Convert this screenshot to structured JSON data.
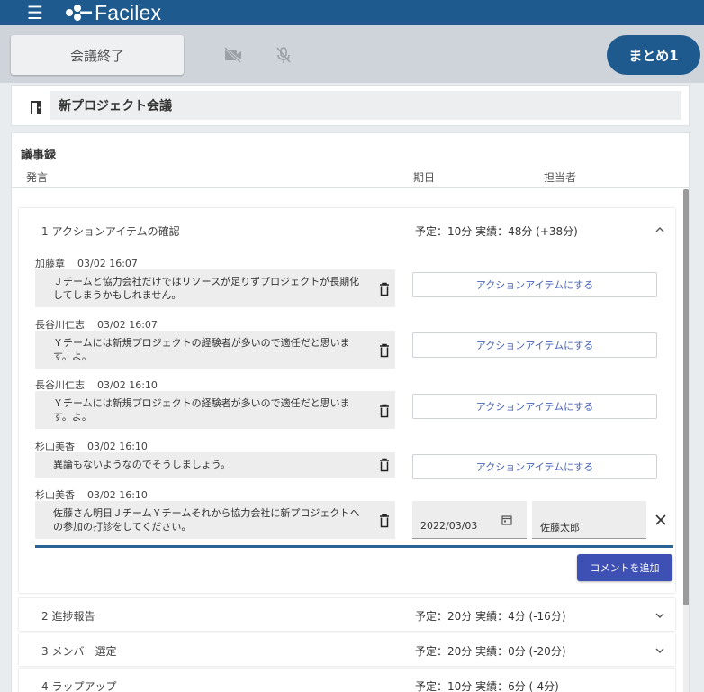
{
  "app": {
    "name": "Facilex"
  },
  "toolbar": {
    "end_meeting_label": "会議終了",
    "summary_label": "まとめ1"
  },
  "meeting": {
    "title": "新プロジェクト会議"
  },
  "minutes": {
    "title": "議事録",
    "columns": {
      "statement": "発言",
      "due_date": "期日",
      "assignee": "担当者"
    }
  },
  "agenda_items": [
    {
      "title": "1 アクションアイテムの確認",
      "time": "予定：10分 実績：48分 (+38分)",
      "comments": [
        {
          "speaker": "加藤章",
          "timestamp": "03/02 16:07",
          "text": "Ｊチームと協力会社だけではリソースが足りずプロジェクトが長期化してしまうかもしれません。",
          "action_label": "アクションアイテムにする"
        },
        {
          "speaker": "長谷川仁志",
          "timestamp": "03/02 16:07",
          "text": "Ｙチームには新規プロジェクトの経験者が多いので適任だと思います。よ。",
          "action_label": "アクションアイテムにする"
        },
        {
          "speaker": "長谷川仁志",
          "timestamp": "03/02 16:10",
          "text": "Ｙチームには新規プロジェクトの経験者が多いので適任だと思います。よ。",
          "action_label": "アクションアイテムにする"
        },
        {
          "speaker": "杉山美香",
          "timestamp": "03/02 16:10",
          "text": "異論もないようなのでそうしましょう。",
          "action_label": "アクションアイテムにする"
        },
        {
          "speaker": "杉山美香",
          "timestamp": "03/02 16:10",
          "text": "佐藤さん明日ＪチームＹチームそれから協力会社に新プロジェクトへの参加の打診をしてください。",
          "due_date": "2022/03/03",
          "assignee": "佐藤太郎"
        }
      ],
      "add_comment_label": "コメントを追加"
    },
    {
      "title": "2 進捗報告",
      "time": "予定：20分 実績：4分 (-16分)"
    },
    {
      "title": "3 メンバー選定",
      "time": "予定：20分 実績：0分 (-20分)"
    },
    {
      "title": "4 ラップアップ",
      "time": "予定：10分 実績：6分 (-4分)"
    }
  ]
}
